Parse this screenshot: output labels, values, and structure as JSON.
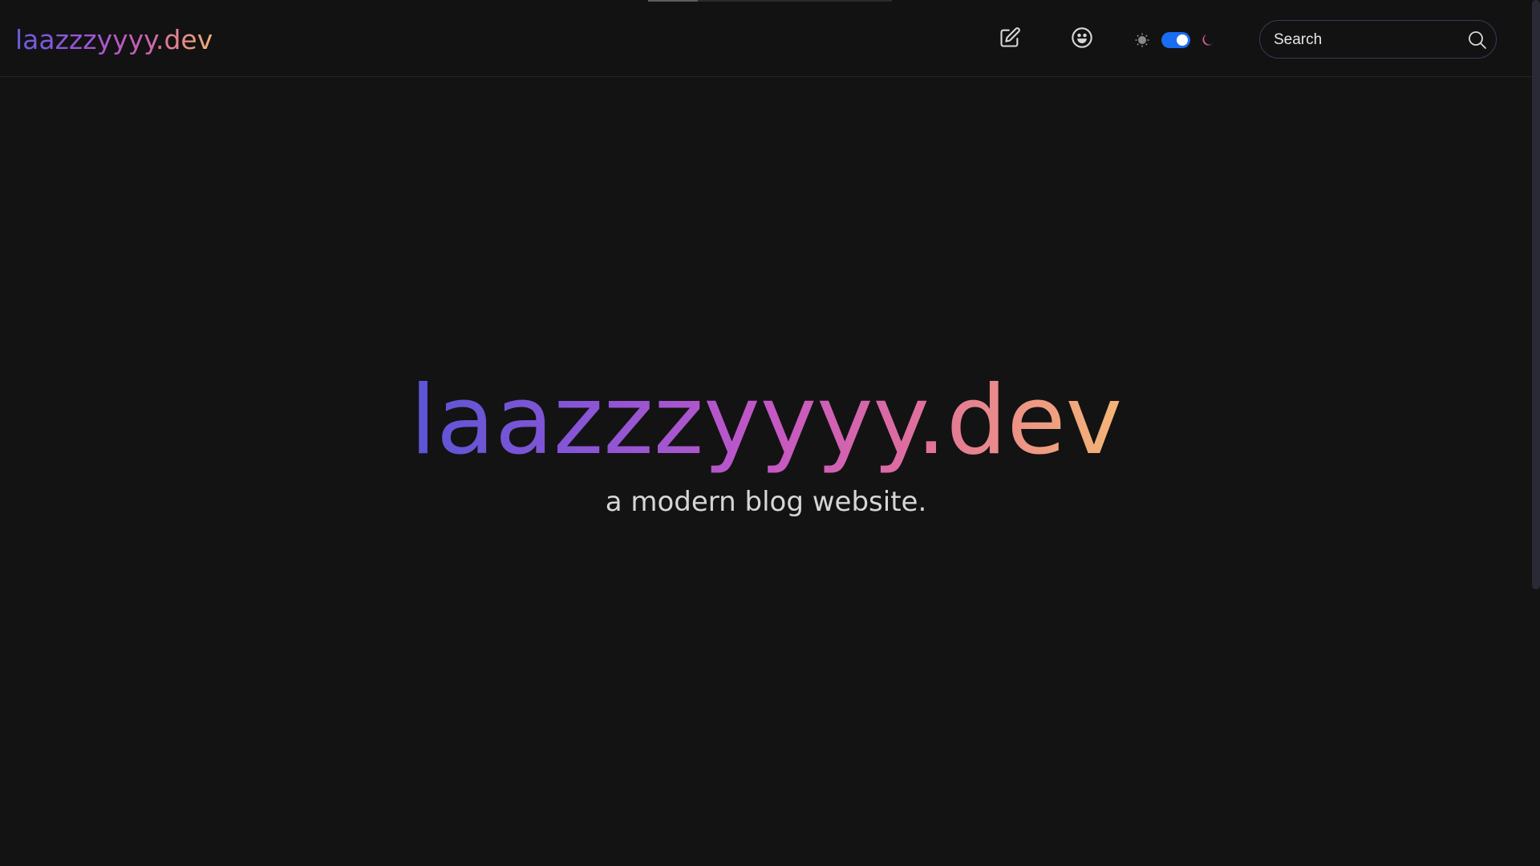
{
  "header": {
    "logo_text": "laazzzyyyy.dev",
    "search": {
      "placeholder": "Search",
      "value": ""
    },
    "icons": {
      "write": "edit-icon",
      "emoji": "smiley-icon",
      "light": "sun-icon",
      "dark": "moon-icon",
      "search": "search-icon"
    },
    "theme_toggle_state": "dark"
  },
  "hero": {
    "title": "laazzzyyyy.dev",
    "subtitle": "a modern blog website."
  },
  "colors": {
    "background": "#131313",
    "accent_blue": "#1a6cf0",
    "moon_pink": "#e2589a",
    "gradient_start": "#5a55d6",
    "gradient_end": "#f4b676"
  }
}
